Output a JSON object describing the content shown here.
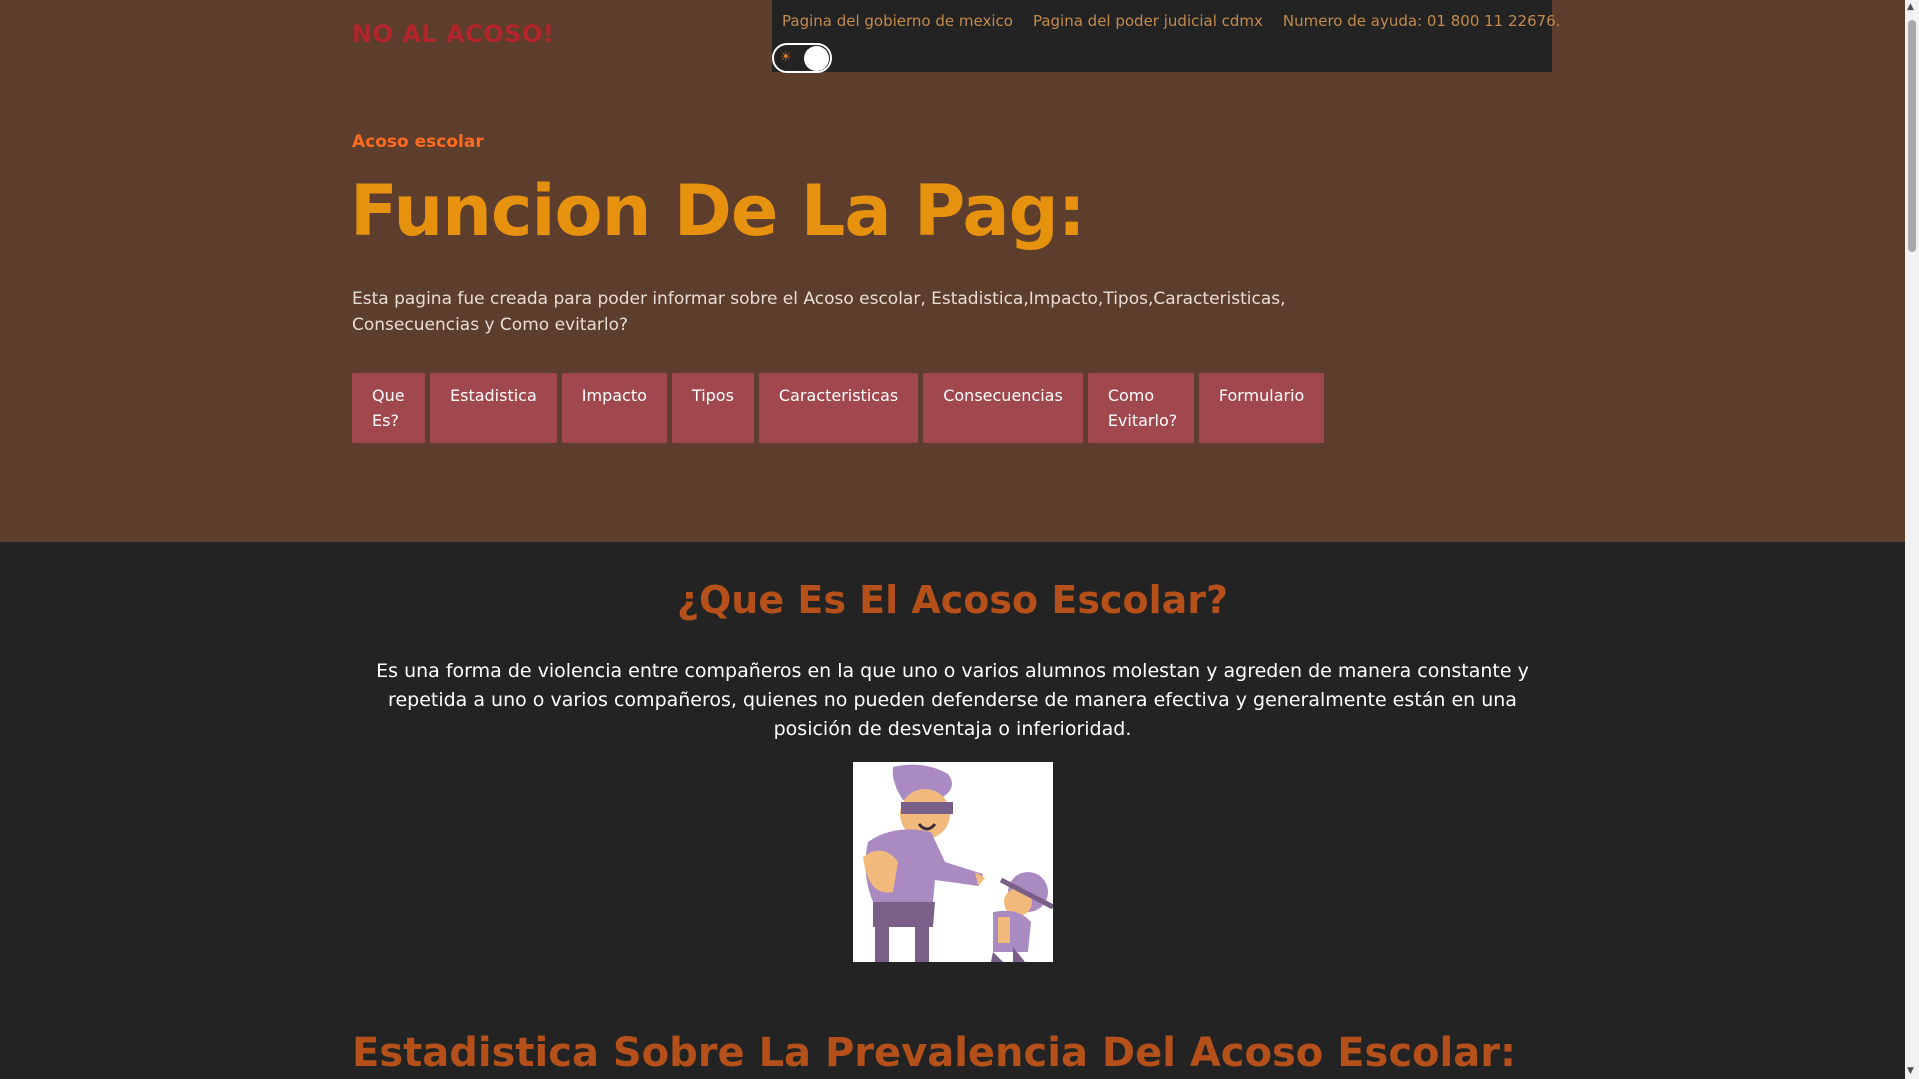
{
  "brand": "NO AL ACOSO!",
  "topnav": {
    "links": [
      "Pagina del gobierno de mexico",
      "Pagina del poder judicial cdmx",
      "Numero de ayuda: 01 800 11 22676."
    ],
    "theme_toggle_icon": "sun-icon"
  },
  "hero": {
    "eyebrow": "Acoso escolar",
    "title": "Funcion De La Pag:",
    "description": "Esta pagina fue creada para poder informar sobre el Acoso escolar, Estadistica,Impacto,Tipos,Caracteristicas, Consecuencias y Como evitarlo?",
    "buttons": [
      "Que Es?",
      "Estadistica",
      "Impacto",
      "Tipos",
      "Caracteristicas",
      "Consecuencias",
      "Como Evitarlo?",
      "Formulario"
    ]
  },
  "section_que_es": {
    "title": "¿Que Es El Acoso Escolar?",
    "text": "Es una forma de violencia entre compañeros en la que uno o varios alumnos molestan y agreden de manera constante y repetida a uno o varios compañeros, quienes no pueden defenderse de manera efectiva y generalmente están en una posición de desventaja o inferioridad."
  },
  "section_estadistica": {
    "title": "Estadistica Sobre La Prevalencia Del Acoso Escolar:"
  },
  "colors": {
    "hero_bg": "#5d3d2c",
    "dark_bg": "#232323",
    "brand": "#b2252b",
    "title": "#e6920f",
    "eyebrow": "#ff6a1e",
    "button_bg": "#a0484e",
    "section_title": "#b5501a"
  }
}
